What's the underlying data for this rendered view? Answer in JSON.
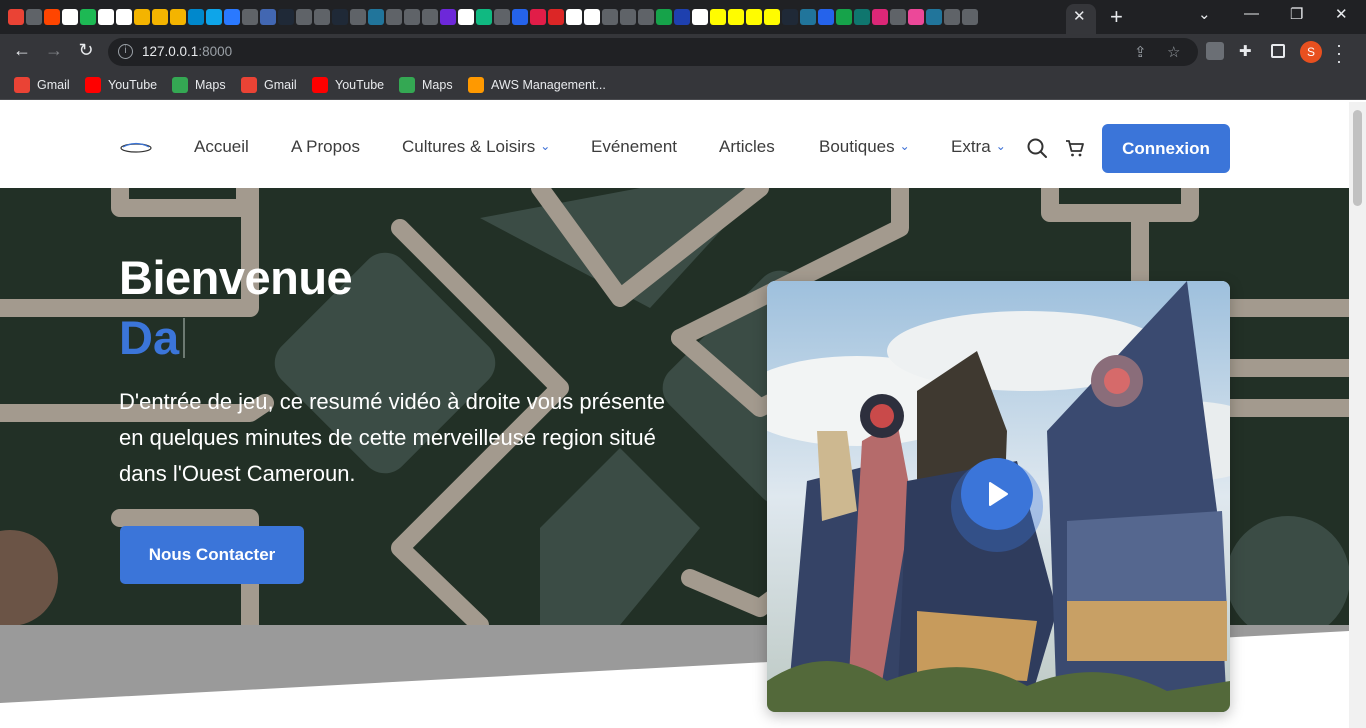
{
  "browser": {
    "url_host": "127.0.0.1",
    "url_port": ":8000",
    "bookmarks": [
      {
        "label": "Gmail",
        "icon": "gmail-icon"
      },
      {
        "label": "YouTube",
        "icon": "youtube-icon"
      },
      {
        "label": "Maps",
        "icon": "maps-icon"
      },
      {
        "label": "Gmail",
        "icon": "gmail-icon"
      },
      {
        "label": "YouTube",
        "icon": "youtube-icon"
      },
      {
        "label": "Maps",
        "icon": "maps-icon"
      },
      {
        "label": "AWS Management...",
        "icon": "aws-icon"
      }
    ],
    "profile_initial": "S"
  },
  "nav": {
    "items": [
      {
        "label": "Accueil"
      },
      {
        "label": "A Propos"
      },
      {
        "label": "Cultures & Loisirs",
        "dropdown": true
      },
      {
        "label": "Evénement"
      },
      {
        "label": "Articles"
      },
      {
        "label": "Boutiques",
        "dropdown": true
      },
      {
        "label": "Extra",
        "dropdown": true
      }
    ],
    "login_label": "Connexion"
  },
  "hero": {
    "title": "Bienvenue",
    "typed": "Da",
    "text": "D'entrée de jeu, ce resumé vidéo à droite vous présente en quelques minutes de cette merveilleuse region situé dans l'Ouest Cameroun.",
    "cta_label": "Nous Contacter"
  },
  "colors": {
    "accent": "#3b75d9",
    "hero_bg": "#223026",
    "hero_shape": "#3b4c45",
    "hero_stroke": "#a39a8e"
  }
}
